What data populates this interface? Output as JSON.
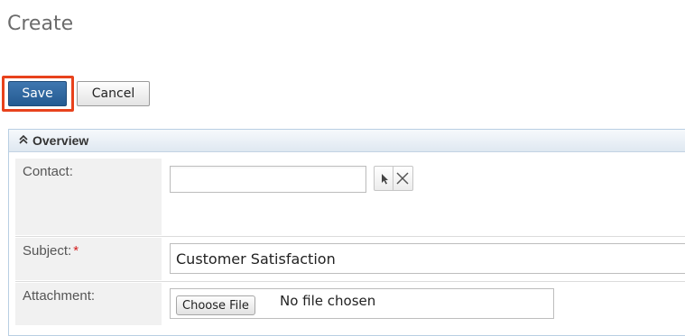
{
  "page": {
    "title": "Create"
  },
  "toolbar": {
    "save_label": "Save",
    "cancel_label": "Cancel"
  },
  "panel": {
    "title": "Overview"
  },
  "fields": {
    "contact": {
      "label": "Contact:",
      "value": ""
    },
    "subject": {
      "label": "Subject:",
      "required_mark": "*",
      "value": "Customer Satisfaction"
    },
    "attachment": {
      "label": "Attachment:",
      "button_label": "Choose File",
      "status_text": "No file chosen"
    }
  },
  "colors": {
    "save_button": "#2e6aa5",
    "highlight": "#e8421c",
    "required": "#d31d1d"
  },
  "icons": {
    "collapse": "double-chevron-up-icon",
    "select": "arrow-cursor-icon",
    "clear": "close-icon"
  }
}
